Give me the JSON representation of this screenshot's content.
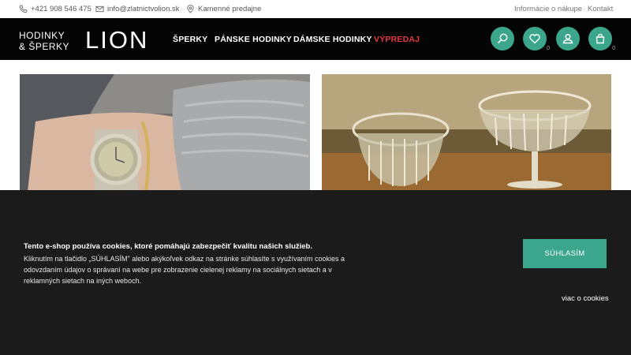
{
  "topbar": {
    "phone": "+421 908 546 475",
    "email": "info@zlatnictvolion.sk",
    "stores": "Kamenné predajne",
    "purchase_info": "Informácie o nákupe",
    "contact": "Kontakt"
  },
  "logo": {
    "line1": "HODINKY",
    "line2": "& ŠPERKY",
    "brand": "LION"
  },
  "nav": {
    "items": [
      "ŠPERKY",
      "PÁNSKE HODINKY",
      "DÁMSKE HODINKY",
      "VÝPREDAJ"
    ]
  },
  "header_icons": {
    "search": "search-icon",
    "wishlist": "heart-icon",
    "wishlist_count": "0",
    "account": "user-icon",
    "cart": "cart-icon",
    "cart_count": "0"
  },
  "colors": {
    "accent": "#3ba68c",
    "sale": "#e8363e",
    "header_bg": "#050505",
    "cookie_bg": "#1b1b1b"
  },
  "cookie": {
    "title": "Tento e-shop používa cookies, ktoré pomáhajú zabezpečiť kvalitu našich služieb.",
    "body": "Kliknutím na tlačidlo „SÚHLASÍM\" alebo akýkoľvek odkaz na stránke súhlasíte s využívaním cookies a odovzdaním údajov o správaní na webe pre zobrazenie cielenej reklamy na sociálnych sietach a v reklamných sietach na iných weboch.",
    "accept_label": "SÚHLASÍM",
    "more_label": "viac o cookies"
  }
}
